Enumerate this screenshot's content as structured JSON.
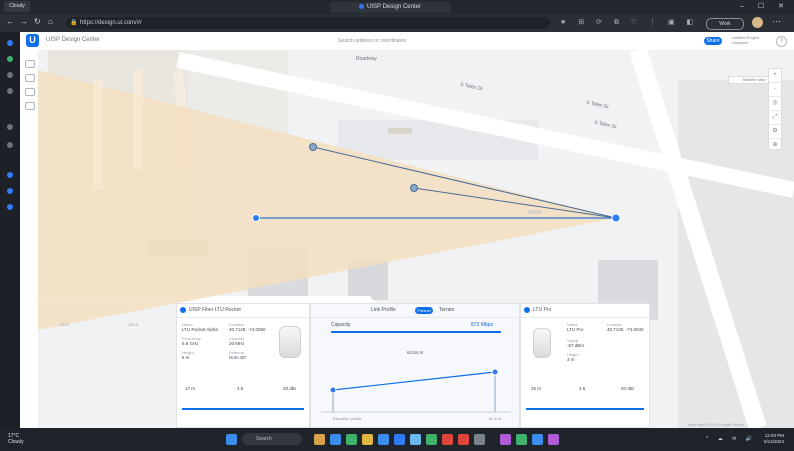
{
  "window": {
    "info_label": "Cloudy",
    "tab_title": "UISP Design Center",
    "controls": "– ☐ ✕"
  },
  "address_bar": {
    "url": "https://design.ui.com/#/",
    "profile_label": "Work",
    "menu": "⋯"
  },
  "app": {
    "title": "UISP Design Center",
    "search_placeholder": "Search address or coordinates",
    "sign_in": "Share",
    "user_line1": "Untitled Project",
    "user_line2": "Unsaved",
    "help": "?"
  },
  "map": {
    "roads": [
      "Roadway",
      "S Telex Dr",
      "S Telex Dr",
      "S Telex Dr"
    ],
    "layer_chip": "Satellite  Map",
    "controls": [
      "+",
      "−",
      "◎",
      "⤢",
      "⚙",
      "⊕"
    ],
    "scale_labels": [
      "20 m",
      "100 ft"
    ],
    "attribution": "Map data ©2024 Google  Terms"
  },
  "left_panel": {
    "title": "UISP Fiber LTU Rocket",
    "fields": [
      {
        "label": "Name",
        "value": "LTU Rocket Alpha"
      },
      {
        "label": "Location",
        "value": "40.7128, -74.0060"
      },
      {
        "label": "Frequency",
        "value": "5.8 GHz"
      },
      {
        "label": "Channel",
        "value": "20 MHz"
      },
      {
        "label": "Height",
        "value": "5 m"
      },
      {
        "label": "Antenna",
        "value": "Horn 30°"
      }
    ],
    "bottom_values": [
      "17 m",
      "4.6",
      "20 dBi"
    ]
  },
  "middle_panel": {
    "tabs": [
      "Link Profile",
      "Fresnel",
      "Terrain"
    ],
    "active_tab": "Fresnel",
    "speed_label": "Capacity",
    "speed_value": "872 Mbps",
    "distance": "62.64 m",
    "footer_left": "Elevation profile",
    "footer_right": "62.6 m"
  },
  "right_panel": {
    "title": "LTU Pro",
    "fields": [
      {
        "label": "Name",
        "value": "LTU Pro"
      },
      {
        "label": "Location",
        "value": "40.7130, -74.0040"
      },
      {
        "label": "Signal",
        "value": "-57 dBm"
      },
      {
        "label": "Height",
        "value": "3 m"
      }
    ],
    "bottom_values": [
      "25 m",
      "4.6",
      "20 dBi"
    ]
  },
  "taskbar": {
    "weather_temp": "17°C",
    "weather_desc": "Cloudy",
    "search_placeholder": "Search",
    "tray": "^ ☁ ✉ 🔊",
    "time": "12:03 PM",
    "date": "5/14/2024"
  },
  "colors": {
    "accent": "#0e6fe8",
    "coverage": "#f3dfc0",
    "tab_dot": "#2f7bf5"
  }
}
